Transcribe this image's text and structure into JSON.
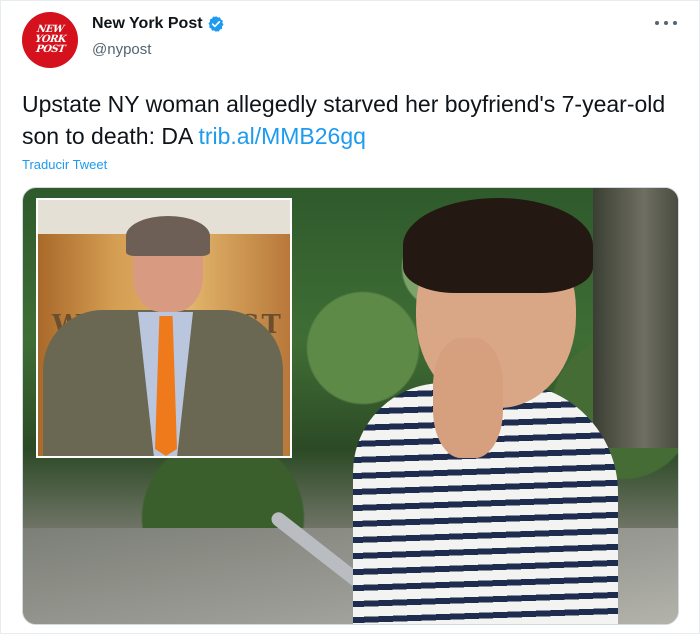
{
  "account": {
    "display_name": "New York Post",
    "handle": "@nypost",
    "avatar_lines": [
      "NEW",
      "YORK",
      "POST"
    ],
    "verified": true
  },
  "tweet": {
    "text": "Upstate NY woman allegedly starved her boyfriend's 7-year-old son to death: DA ",
    "link_text": "trib.al/MMB26gq"
  },
  "translate_label": "Traducir Tweet",
  "media": {
    "inset_wall_text_left": "WE",
    "inset_wall_text_right": "UST"
  },
  "icons": {
    "verified": "verified-badge-icon",
    "more": "more-options-icon"
  },
  "colors": {
    "link": "#1d9bf0",
    "text": "#0f1419",
    "secondary": "#536471",
    "brand_red": "#d4111c"
  }
}
